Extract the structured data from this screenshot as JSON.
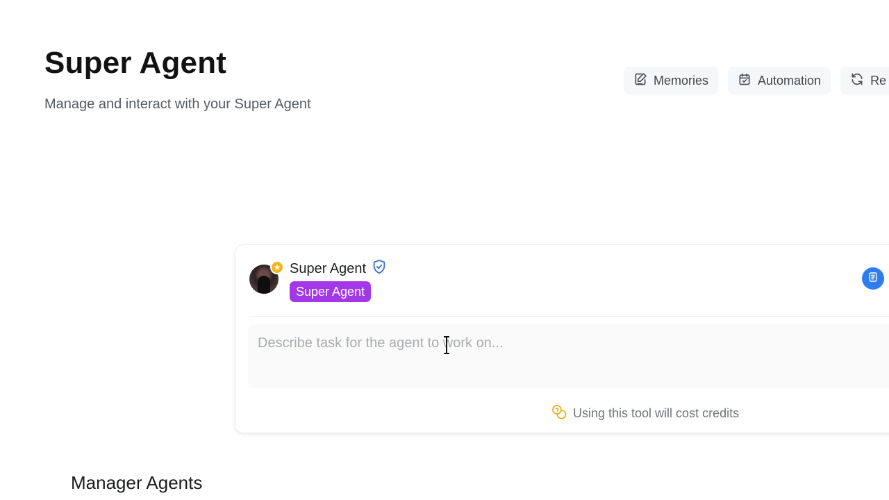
{
  "header": {
    "title": "Super Agent",
    "subtitle": "Manage and interact with your Super Agent"
  },
  "toolbar": {
    "memories_label": "Memories",
    "automation_label": "Automation",
    "refresh_label": "Re"
  },
  "agent_card": {
    "name": "Super Agent",
    "badge": "Super Agent",
    "task_input": {
      "value": "",
      "placeholder": "Describe task for the agent to work on..."
    },
    "credit_note": "Using this tool will cost credits"
  },
  "sections": {
    "manager_agents_title": "Manager Agents"
  },
  "colors": {
    "badge_purple": "#a238e8",
    "doc_button_blue": "#2f7cf0",
    "star_yellow": "#f2b61b",
    "verified_blue": "#3b6fd8"
  },
  "icons": {
    "memories": "edit-note-icon",
    "automation": "calendar-icon",
    "refresh": "refresh-icon",
    "verified": "shield-check-icon",
    "star": "star-icon",
    "document": "document-icon",
    "credits": "coins-icon"
  }
}
